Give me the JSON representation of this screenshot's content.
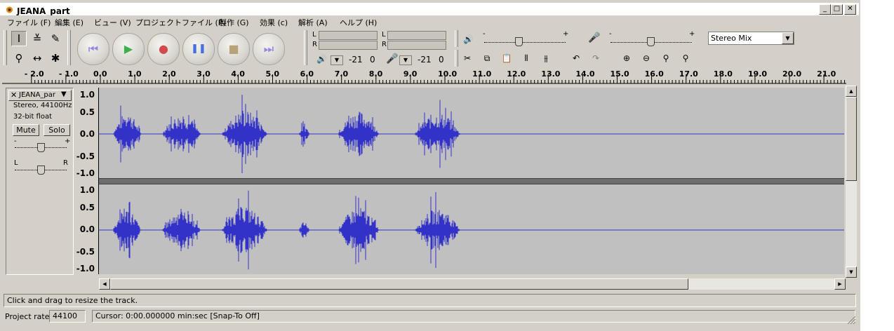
{
  "window": {
    "title": "JEANA_part",
    "minimize_glyph": "_",
    "maximize_glyph": "□",
    "close_glyph": "✕"
  },
  "menu": [
    {
      "label": "ファイル (F)"
    },
    {
      "label": "編集 (E)"
    },
    {
      "label": "ビュー (V)"
    },
    {
      "label": "プロジェクトファイル (P)"
    },
    {
      "label": "製作 (G)"
    },
    {
      "label": "効果 (c)"
    },
    {
      "label": "解析 (A)"
    },
    {
      "label": "ヘルプ (H)"
    }
  ],
  "tools": {
    "selection": "I",
    "envelope": "≚",
    "draw": "✎",
    "zoom": "⚲",
    "timeshift": "↔",
    "multi": "✱"
  },
  "transport": {
    "skip_start": "⏮",
    "play": "▶",
    "record": "●",
    "pause": "❚❚",
    "stop": "■",
    "skip_end": "⏭",
    "colors": {
      "skip": "#9a82e6",
      "play": "#3cb04a",
      "record": "#d24a4a",
      "pause": "#4a6ee0",
      "stop": "#b8a27a"
    }
  },
  "meters": {
    "play_L": "L",
    "play_R": "R",
    "rec_L": "L",
    "rec_R": "R",
    "play_db": "-21",
    "play_zero": "0",
    "rec_db": "-21",
    "rec_zero": "0"
  },
  "mixer": {
    "output_minus": "-",
    "output_plus": "+",
    "input_minus": "-",
    "input_plus": "+",
    "input_source": "Stereo Mix"
  },
  "ruler": {
    "labels": [
      "- 2.0",
      "- 1.0",
      "0.0",
      "1.0",
      "2.0",
      "3.0",
      "4.0",
      "5.0",
      "6.0",
      "7.0",
      "8.0",
      "9.0",
      "10.0",
      "11.0",
      "12.0",
      "13.0",
      "14.0",
      "15.0",
      "16.0",
      "17.0",
      "18.0",
      "19.0",
      "20.0",
      "21.0"
    ]
  },
  "track": {
    "close": "✕",
    "name": "JEANA_par",
    "format": "Stereo, 44100Hz",
    "bitdepth": "32-bit float",
    "mute": "Mute",
    "solo": "Solo",
    "gain_minus": "-",
    "gain_plus": "+",
    "pan_left": "L",
    "pan_right": "R",
    "scale": [
      "1.0",
      "0.5",
      "0.0",
      "-0.5",
      "-1.0"
    ],
    "wave_color": "#3232c8"
  },
  "status": {
    "message": "Click and drag to resize the track.",
    "project_rate_label": "Project rate:",
    "project_rate_value": "44100",
    "cursor_text": "Cursor: 0:00.000000 min:sec   [Snap-To Off]"
  }
}
